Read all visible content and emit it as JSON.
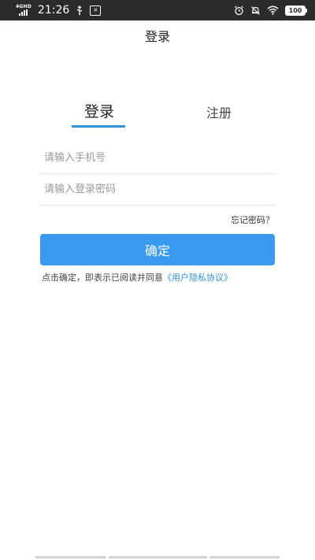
{
  "status_bar": {
    "network": "4G",
    "network_sub": "HD",
    "time": "21:26",
    "ac_icon_text": "✕",
    "battery": "100"
  },
  "header": {
    "title": "登录"
  },
  "tabs": {
    "login": "登录",
    "register": "注册",
    "active": "login"
  },
  "form": {
    "phone_placeholder": "请输入手机号",
    "password_placeholder": "请输入登录密码",
    "forgot_password": "忘记密码？",
    "confirm_label": "确定"
  },
  "agreement": {
    "prefix": "点击确定，即表示已阅读并同意",
    "link": "《用户隐私协议》"
  },
  "colors": {
    "accent": "#2f93e0",
    "button": "#3a99f0",
    "status_bar_bg": "#2b2b2b"
  }
}
